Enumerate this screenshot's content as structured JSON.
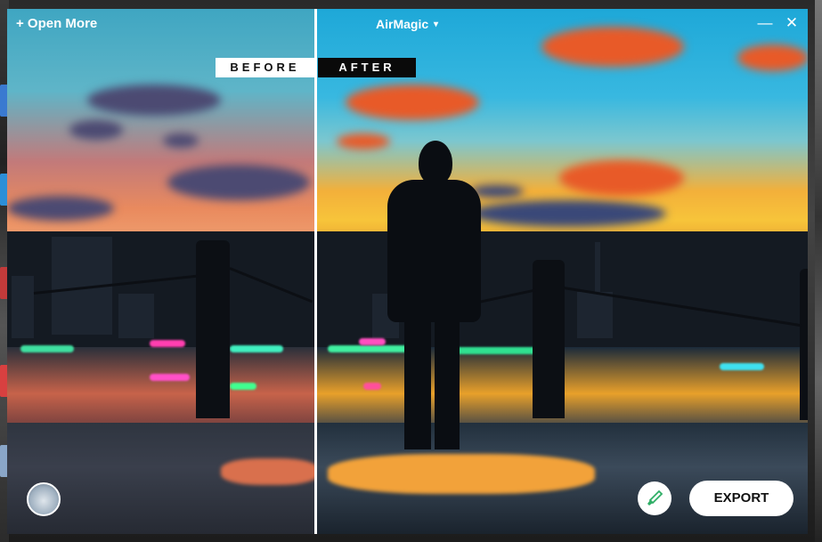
{
  "toolbar": {
    "open_more_label": "+ Open More",
    "app_title": "AirMagic",
    "app_title_caret": "▾",
    "minimize_glyph": "—",
    "close_glyph": "✕"
  },
  "comparison": {
    "before_label": "BEFORE",
    "after_label": "AFTER"
  },
  "actions": {
    "export_label": "EXPORT",
    "edit_icon": "brush-icon"
  },
  "colors": {
    "accent": "#ffffff",
    "brush_icon": "#2fae66"
  }
}
